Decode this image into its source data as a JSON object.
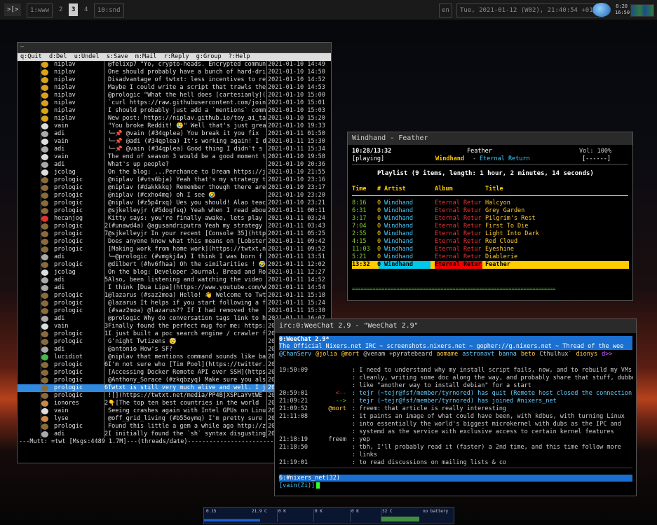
{
  "topbar": {
    "launcher": ">[>",
    "workspaces": [
      {
        "label": "1:www",
        "active": false
      },
      {
        "label": "2",
        "active": false
      },
      {
        "label": "3",
        "active": true
      },
      {
        "label": "4",
        "active": false
      },
      {
        "label": "10:snd",
        "active": false
      }
    ],
    "lang": "en",
    "datetime": "Tue, 2021-01-12 (W02), 21:40:54 +0100",
    "clock1": "8:20",
    "clock2": "16:50"
  },
  "mutt": {
    "title": "—",
    "help": "q:Quit  d:Del  u:Undel  s:Save  m:Mail  r:Reply  g:Group  ?:Help",
    "status": "---Mutt: =twt [Msgs:4489 1.7M]---(threads/date)--------------------------------------(end)---",
    "rows": [
      {
        "c": "",
        "a": "bee",
        "s": "niplav",
        "n": "",
        "m": "@felixp7 \"Yo, crypto-heads. Encrypted commun",
        "d": "2021-01-10 14:49"
      },
      {
        "c": "",
        "a": "bee",
        "s": "niplav",
        "n": "",
        "m": "One should probably have a bunch of hard-dri",
        "d": "2021-01-10 14:50"
      },
      {
        "c": "",
        "a": "bee",
        "s": "niplav",
        "n": "",
        "m": "Disadvantage of twtxt: less incentives to re",
        "d": "2021-01-10 14:52"
      },
      {
        "c": "",
        "a": "bee",
        "s": "niplav",
        "n": "",
        "m": "Maybe I could write a script that trawls the",
        "d": "2021-01-10 14:53"
      },
      {
        "c": "",
        "a": "bee",
        "s": "niplav",
        "n": "",
        "m": "@prologic \"What the hell does [cartesianly](",
        "d": "2021-01-10 15:00"
      },
      {
        "c": "",
        "a": "bee",
        "s": "niplav",
        "n": "",
        "m": "`curl https://raw.githubusercontent.com/join",
        "d": "2021-01-10 15:01"
      },
      {
        "c": "",
        "a": "bee",
        "s": "niplav",
        "n": "",
        "m": "I should probably just add a `mentions` comm",
        "d": "2021-01-10 15:03"
      },
      {
        "c": "",
        "a": "bee",
        "s": "niplav",
        "n": "",
        "m": "New post: https://niplav.github.io/toy_ai_ta",
        "d": "2021-01-10 15:20"
      },
      {
        "c": "",
        "a": "robot",
        "s": "vain",
        "n": "",
        "m": "\"You broke Reddit! 😢\" Well that's just grea",
        "d": "2021-01-10 19:33"
      },
      {
        "c": "",
        "a": "ghost",
        "s": "adi",
        "n": "",
        "m": "└─📌 @vain (#34qplea) You break it you fix",
        "d": "2021-01-11 01:50"
      },
      {
        "c": "",
        "a": "robot",
        "s": "vain",
        "n": "",
        "m": "  └─📌 @adi (#34qplea) It's working again! I did",
        "d": "2021-01-11 15:30"
      },
      {
        "c": "",
        "a": "ghost",
        "s": "adi",
        "n": "",
        "m": "    └─📌 @vain (#34qplea) Good thing I didn't s",
        "d": "2021-01-11 15:34"
      },
      {
        "c": "",
        "a": "robot",
        "s": "vain",
        "n": "",
        "m": "The end of season 3 would be a good moment t",
        "d": "2021-01-10 19:58"
      },
      {
        "c": "",
        "a": "ghost",
        "s": "adi",
        "n": "",
        "m": "What's up people?",
        "d": "2021-01-10 20:36"
      },
      {
        "c": "",
        "a": "cow",
        "s": "jcolag",
        "n": "",
        "m": "On the blog: ...Perchance to Dream https://j",
        "d": "2021-01-10 21:55"
      },
      {
        "c": "",
        "a": "box",
        "s": "prologic",
        "n": "",
        "m": "@niplav (#vts6bja) Yeah that's my strategy t",
        "d": "2021-01-10 23:16"
      },
      {
        "c": "",
        "a": "box",
        "s": "prologic",
        "n": "",
        "m": "@niplav (#dakkkkq) Remember though there are",
        "d": "2021-01-10 23:17"
      },
      {
        "c": "",
        "a": "box",
        "s": "prologic",
        "n": "",
        "m": "@niplav (#cxho4mq) oh I see 🤣",
        "d": "2021-01-10 23:20"
      },
      {
        "c": "",
        "a": "box",
        "s": "prologic",
        "n": "",
        "m": "@niplav (#z5p4rxq) Ues you should! Alao teac",
        "d": "2021-01-10 23:21"
      },
      {
        "c": "",
        "a": "box",
        "s": "prologic",
        "n": "",
        "m": "@sjkelleyjr (#5dogfsq) Yeah when I read abou",
        "d": "2021-01-11 00:11"
      },
      {
        "c": "",
        "a": "red",
        "s": "hecanjog",
        "n": "",
        "m": "Kitty says: you're finally awake, lets play ",
        "d": "2021-01-11 03:24"
      },
      {
        "c": "",
        "a": "box",
        "s": "prologic",
        "n": "2",
        "m": "(#unawd4a) @agusandriputra Yeah my strategy ",
        "d": "2021-01-11 03:43"
      },
      {
        "c": "",
        "a": "box",
        "s": "prologic",
        "n": "7",
        "m": "@sjkelleyjr In your recent [Console 35](http",
        "d": "2021-01-11 05:25"
      },
      {
        "c": "",
        "a": "box",
        "s": "prologic",
        "n": "",
        "m": "Does anyone know what this means on [Lobster",
        "d": "2021-01-11 09:42"
      },
      {
        "c": "",
        "a": "box",
        "s": "prologic",
        "n": "",
        "m": "[Making work from home work](https://twtxt.n",
        "d": "2021-01-11 09:52"
      },
      {
        "c": "",
        "a": "ghost",
        "s": "adi",
        "n": "",
        "m": "└─@prologic (#vmgkj4a) I think I was born f",
        "d": "2021-01-11 13:51"
      },
      {
        "c": "",
        "a": "box",
        "s": "prologic",
        "n": "",
        "m": "@dilbert (#hv6fhaa) Oh the similarities ! 🤣",
        "d": "2021-01-11 12:02"
      },
      {
        "c": "",
        "a": "cow",
        "s": "jcolag",
        "n": "",
        "m": "On the blog: Developer Journal, Bread and Ro",
        "d": "2021-01-11 12:27"
      },
      {
        "c": "",
        "a": "ghost",
        "s": "adi",
        "n": "5",
        "m": "Also, been listening and watching the video ",
        "d": "2021-01-11 14:52"
      },
      {
        "c": "",
        "a": "ghost",
        "s": "adi",
        "n": "",
        "m": "I think [Dua Lipa](https://www.youtube.com/w",
        "d": "2021-01-11 14:54"
      },
      {
        "c": "",
        "a": "box",
        "s": "prologic",
        "n": "16",
        "m": "@lazarus (#saz2moa) Hello! 👋 Welcome to Twt",
        "d": "2021-01-11 15:18"
      },
      {
        "c": "",
        "a": "box",
        "s": "prologic",
        "n": "",
        "m": "@lazarus It helps if you start following a f",
        "d": "2021-01-11 15:24"
      },
      {
        "c": "",
        "a": "box",
        "s": "prologic",
        "n": "",
        "m": "(#saz2moa) @lazarus?? If I had removed the ",
        "d": "2021-01-11 15:30"
      },
      {
        "c": "",
        "a": "ghost",
        "s": "adi",
        "n": "",
        "m": "@prologic Why do conversation tags link to h",
        "d": "2021-01-11 16:07"
      },
      {
        "c": "",
        "a": "robot",
        "s": "vain",
        "n": "3",
        "m": "Finally found the perfect mug for me: https:",
        "d": "2021-01-11 16:17"
      },
      {
        "c": "",
        "a": "box",
        "s": "prologic",
        "n": "17",
        "m": "I just built a poc search engine / crawler f",
        "d": "2021-01-11 16:22"
      },
      {
        "c": "",
        "a": "box",
        "s": "prologic",
        "n": "",
        "m": "G'night Twtizens 😴",
        "d": "2021-01-11 16:35"
      },
      {
        "c": "",
        "a": "ghost",
        "s": "adi",
        "n": "",
        "m": "@antonio How's SF?",
        "d": "2021-01-11 17:28"
      },
      {
        "c": "",
        "a": "green",
        "s": "lucidiot",
        "n": "",
        "m": "@niplav that mentions command sounds like ba",
        "d": "2021-01-11 17:55"
      },
      {
        "c": "",
        "a": "box",
        "s": "prologic",
        "n": "6",
        "m": "I'm not sure who [Tim Pool](https://twitter.",
        "d": "2021-01-11 18:03"
      },
      {
        "c": "",
        "a": "box",
        "s": "prologic",
        "n": "",
        "m": "[Accessing Docker Remote API over SSH](https",
        "d": "2021-01-11 18:06"
      },
      {
        "c": "",
        "a": "box",
        "s": "prologic",
        "n": "",
        "m": "@Anthony_Sorace (#zkqbzyq) Make sure you als",
        "d": "2021-01-11 18:10"
      },
      {
        "c": "",
        "a": "box",
        "s": "prologic",
        "n": "6",
        "m": "Twtxt is still very much alive and well. I j",
        "d": "2021-01-11 18:21",
        "sel": true
      },
      {
        "c": "",
        "a": "box",
        "s": "prologic",
        "n": "",
        "m": "![](https://twtxt.net/media/PP4BjXSPLaYvtWE",
        "d": "2021-01-11 18:53"
      },
      {
        "c": "",
        "a": "flower",
        "s": "ionores",
        "n": "2",
        "m": "👇[The top ten best countries in the world",
        "d": "2021-01-11 19:25"
      },
      {
        "c": "",
        "a": "robot",
        "s": "vain",
        "n": "",
        "m": "Seeing crashes again with Intel GPUs on Linu",
        "d": "2021-01-11 19:50"
      },
      {
        "c": "",
        "a": "flower",
        "s": "lyse",
        "n": "",
        "m": "@off_grid_living (#b55oymq) I'm pretty sure ",
        "d": "2021-01-11 20:08"
      },
      {
        "c": "",
        "a": "box",
        "s": "prologic",
        "n": "",
        "m": "Found this little a gem a while ago http://z",
        "d": "2021-01-11 20:23"
      },
      {
        "c": "",
        "a": "ghost",
        "s": "adi",
        "n": "2",
        "m": "I initially found the `sh` syntax disgusting",
        "d": "2021-01-11 20:26"
      }
    ]
  },
  "ncmpcpp": {
    "title": "Windhand - Feather",
    "time": "10:28/13:32",
    "track": "Feather",
    "vol": "Vol: 100%",
    "state": "[playing]",
    "artist": "Windhand",
    "sep": "-",
    "album": "Eternal Return",
    "flags": "[------]",
    "playlist": "Playlist (9 items, length: 1 hour, 2 minutes, 14 seconds)",
    "headers": {
      "time": "Time",
      "num": "#",
      "artist": "Artist",
      "album": "Album",
      "title": "Title"
    },
    "tracks": [
      {
        "t": "8:16",
        "n": "0",
        "a": "Windhand",
        "al": "Eternal Retur",
        "ti": "Halcyon"
      },
      {
        "t": "6:31",
        "n": "0",
        "a": "Windhand",
        "al": "Eternal Retur",
        "ti": "Grey Garden"
      },
      {
        "t": "3:17",
        "n": "0",
        "a": "Windhand",
        "al": "Eternal Retur",
        "ti": "Pilgrim's Rest"
      },
      {
        "t": "7:04",
        "n": "0",
        "a": "Windhand",
        "al": "Eternal Retur",
        "ti": "First To Die"
      },
      {
        "t": "2:55",
        "n": "0",
        "a": "Windhand",
        "al": "Eternal Retur",
        "ti": "Light Into Dark"
      },
      {
        "t": "4:15",
        "n": "0",
        "a": "Windhand",
        "al": "Eternal Retur",
        "ti": "Red Cloud"
      },
      {
        "t": "11:03",
        "n": "0",
        "a": "Windhand",
        "al": "Eternal Retur",
        "ti": "Eyeshine"
      },
      {
        "t": "5:21",
        "n": "0",
        "a": "Windhand",
        "al": "Eternal Retur",
        "ti": "Diablerie"
      },
      {
        "t": "13:32",
        "n": "0",
        "a": "Windhand",
        "al": "Eternal Retur",
        "ti": "Feather",
        "current": true
      }
    ],
    "progress": 0.77,
    "progress_bar": "=====================================================================>"
  },
  "weechat": {
    "title": "irc:0:WeeChat 2.9 - \"WeeChat 2.9\"",
    "buffer": "0:WeeChat 2.9*",
    "topic": "The Official Nixers.net IRC ~ screenshots.nixers.net ~ gopher://g.nixers.net ~ Thread of the wee",
    "nicklist": [
      {
        "n": "@ChanServ",
        "c": "#6cf"
      },
      {
        "n": "@jolia",
        "c": "#fc4"
      },
      {
        "n": "@mort",
        "c": "#fc4"
      },
      {
        "n": "@venam",
        "c": "#ccc"
      },
      {
        "n": "+pyratebeard",
        "c": "#ccc"
      },
      {
        "n": "aomame",
        "c": "#fc4"
      },
      {
        "n": "astronavt",
        "c": "#6cf"
      },
      {
        "n": "banna",
        "c": "#6cf"
      },
      {
        "n": "beto",
        "c": "#fc4"
      },
      {
        "n": "Cthulhux`",
        "c": "#ccc"
      },
      {
        "n": "dionys",
        "c": "#fc4"
      },
      {
        "n": "d>>",
        "c": "#c6f"
      }
    ],
    "lines": [
      {
        "t": "19:50:09",
        "n": "",
        "nc": "#ccc",
        "m": ": I need to understand why my install script fails, now, and to rebuild my VMs",
        "mc": "#ccc"
      },
      {
        "t": "",
        "n": "",
        "nc": "#ccc",
        "m": ": cleanly, writing some doc along the way, and probably share that stuff, dubbed",
        "mc": "#ccc"
      },
      {
        "t": "",
        "n": "",
        "nc": "#ccc",
        "m": ": like \"another way to install debian\" for a start",
        "mc": "#ccc"
      },
      {
        "t": "20:59:01",
        "n": "<--",
        "nc": "#e33",
        "m": ": tejr (~tejr@fsf/member/tyrnored) has quit (Remote host closed the connection)",
        "mc": "#6cf"
      },
      {
        "t": "21:09:21",
        "n": "-->",
        "nc": "#5c3",
        "m": ": tejr (~tejr@fsf/member/tyrnored) has joined #nixers_net",
        "mc": "#6cf"
      },
      {
        "t": "21:09:52",
        "n": "@mort",
        "nc": "#fc4",
        "m": ": freem: that article is really interesting",
        "mc": "#ccc"
      },
      {
        "t": "21:11:08",
        "n": "",
        "nc": "#ccc",
        "m": ": it paints an image of what could have been, with kdbus, with turning Linux",
        "mc": "#ccc"
      },
      {
        "t": "",
        "n": "",
        "nc": "#ccc",
        "m": ": into essentially the world's biggest microkernel with dubs as the IPC and",
        "mc": "#ccc"
      },
      {
        "t": "",
        "n": "",
        "nc": "#ccc",
        "m": ": systemd as the service with exclusive access to certain kernel features",
        "mc": "#ccc"
      },
      {
        "t": "21:18:19",
        "n": "freem",
        "nc": "#ccc",
        "m": ": yep",
        "mc": "#ccc"
      },
      {
        "t": "21:18:50",
        "n": "",
        "nc": "#ccc",
        "m": ": tbh, I'll probably read it (faster) a 2nd time, and this time follow more",
        "mc": "#ccc"
      },
      {
        "t": "",
        "n": "",
        "nc": "#ccc",
        "m": ": links",
        "mc": "#ccc"
      },
      {
        "t": "21:19:01",
        "n": "",
        "nc": "#ccc",
        "m": ": to read discussions on mailing lists & co",
        "mc": "#ccc"
      }
    ],
    "statusbar": "6:#nixers_net(32)",
    "input": "[vain(Zi)]"
  },
  "bottombar": {
    "cpu": "0.15",
    "cpu_load": "21.9 C",
    "net1": "0 K",
    "net2": "0 K",
    "net3": "0 K",
    "temp": "32 C",
    "battery": "no battery"
  },
  "colors": {
    "accent": "#2f8ae0",
    "highlight": "#ffc000",
    "current_track": "#00c8e8"
  }
}
